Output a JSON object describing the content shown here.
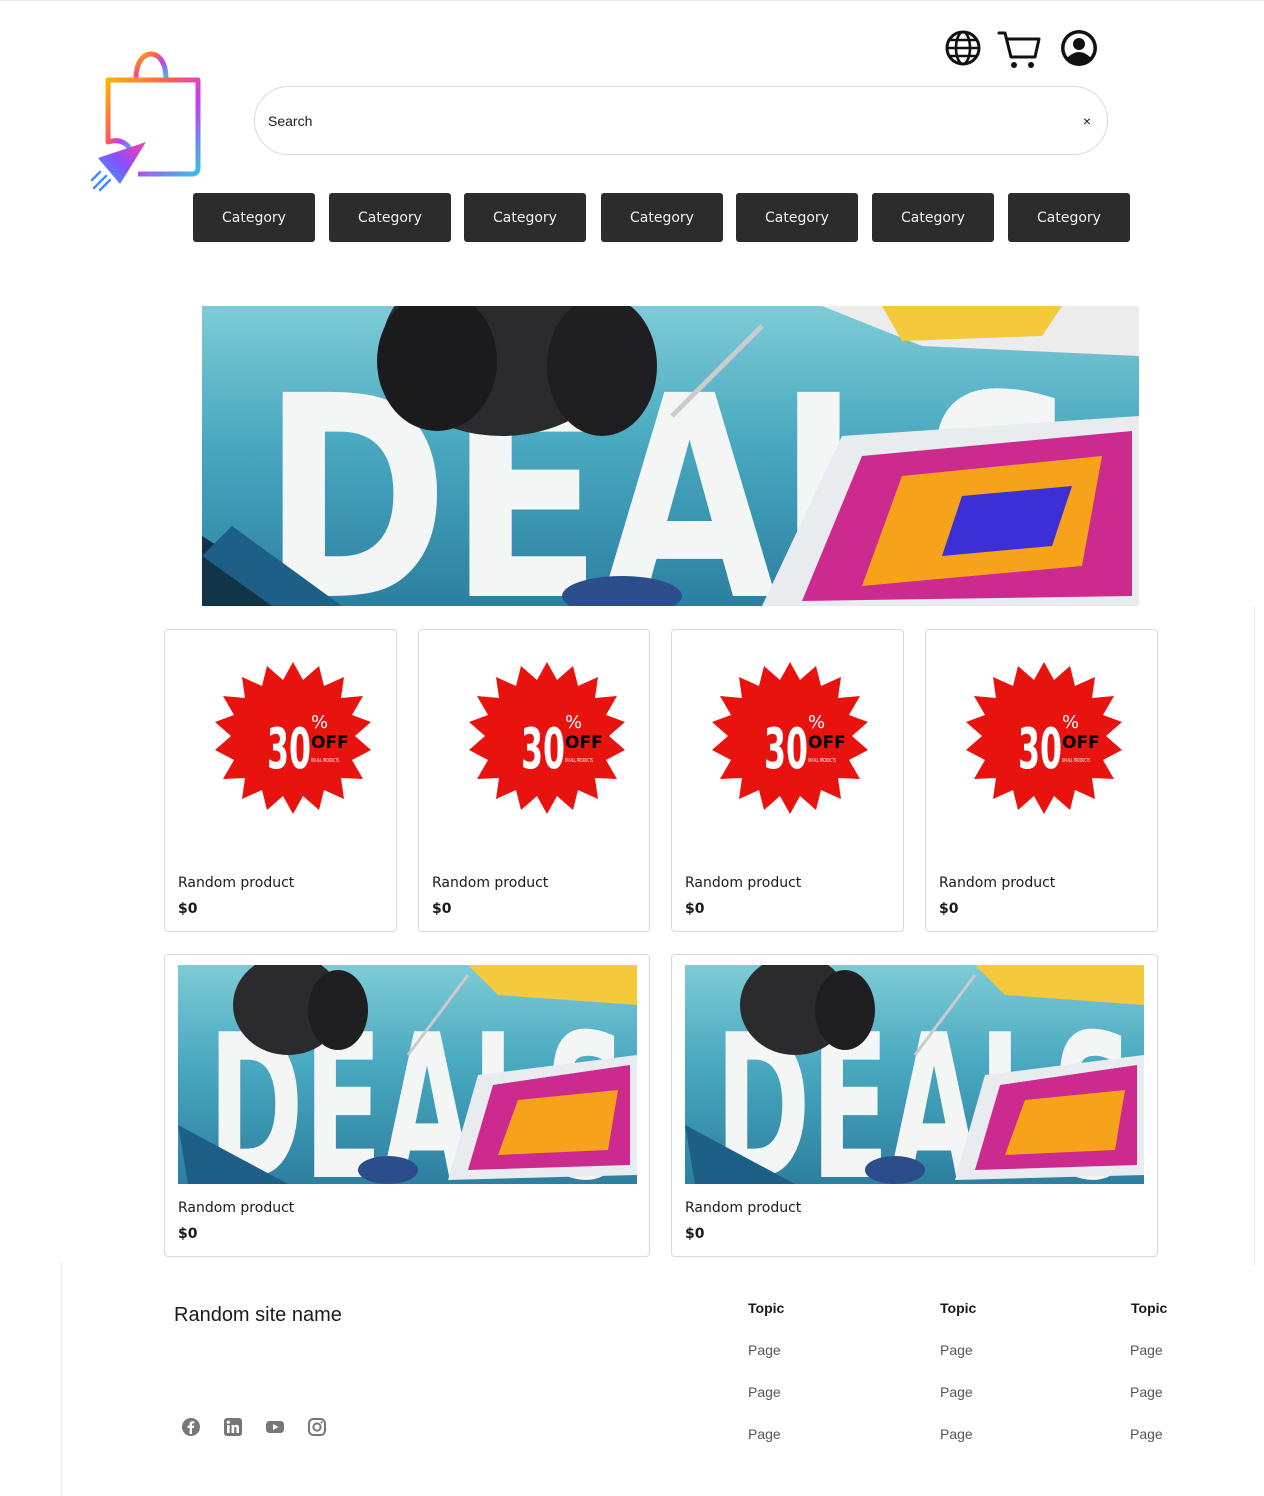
{
  "header": {
    "icons": [
      "globe-icon",
      "cart-icon",
      "account-icon"
    ]
  },
  "search": {
    "placeholder": "Search",
    "value": "",
    "clear_label": "×"
  },
  "categories": [
    "Category",
    "Category",
    "Category",
    "Category",
    "Category",
    "Category",
    "Category"
  ],
  "hero_banner": {
    "image": "deals-banner",
    "text": "DEALS"
  },
  "products_row1": [
    {
      "name": "Random product",
      "price": "$0",
      "image": "30-percent-off-badge",
      "badge_number": "30",
      "badge_percent": "%",
      "badge_off": "OFF",
      "badge_small": "ON ALL PRODUCTS"
    },
    {
      "name": "Random product",
      "price": "$0",
      "image": "30-percent-off-badge",
      "badge_number": "30",
      "badge_percent": "%",
      "badge_off": "OFF",
      "badge_small": "ON ALL PRODUCTS"
    },
    {
      "name": "Random product",
      "price": "$0",
      "image": "30-percent-off-badge",
      "badge_number": "30",
      "badge_percent": "%",
      "badge_off": "OFF",
      "badge_small": "ON ALL PRODUCTS"
    },
    {
      "name": "Random product",
      "price": "$0",
      "image": "30-percent-off-badge",
      "badge_number": "30",
      "badge_percent": "%",
      "badge_off": "OFF",
      "badge_small": "ON ALL PRODUCTS"
    }
  ],
  "products_row2": [
    {
      "name": "Random product",
      "price": "$0",
      "image": "deals-banner"
    },
    {
      "name": "Random product",
      "price": "$0",
      "image": "deals-banner"
    }
  ],
  "footer": {
    "site_name": "Random site name",
    "social_icons": [
      "facebook-icon",
      "linkedin-icon",
      "youtube-icon",
      "instagram-icon"
    ],
    "columns": [
      {
        "topic": "Topic",
        "pages": [
          "Page",
          "Page",
          "Page"
        ]
      },
      {
        "topic": "Topic",
        "pages": [
          "Page",
          "Page",
          "Page"
        ]
      },
      {
        "topic": "Topic",
        "pages": [
          "Page",
          "Page",
          "Page"
        ]
      }
    ]
  },
  "colors": {
    "category_button_bg": "#2c2c2c",
    "badge_red": "#e8130f",
    "deals_teal": "#49a9c0",
    "border": "#d9d9d9"
  }
}
